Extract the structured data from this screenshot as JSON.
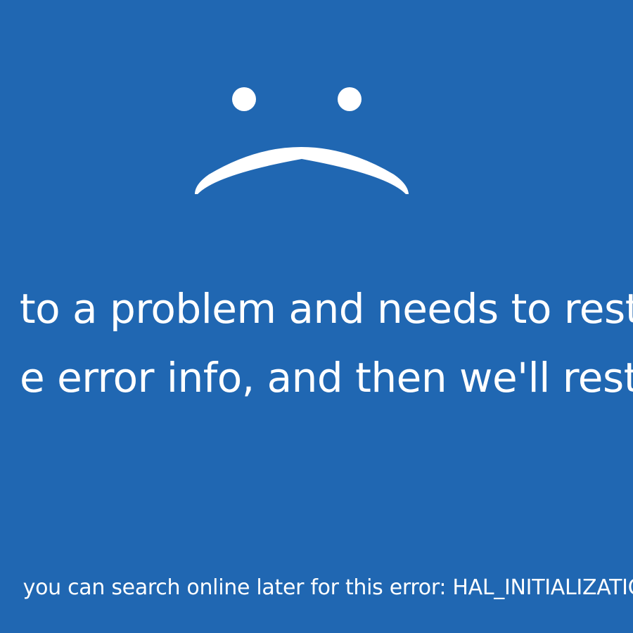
{
  "screen": {
    "background_color": "#2067b2",
    "foreground_color": "#ffffff",
    "face_icon": "sad-face-icon"
  },
  "message": {
    "line1": "to a problem and needs to resta",
    "line2": "e error info, and then we'll resta"
  },
  "error": {
    "hint_text": "you can search online later for this error: HAL_INITIALIZATIO"
  }
}
